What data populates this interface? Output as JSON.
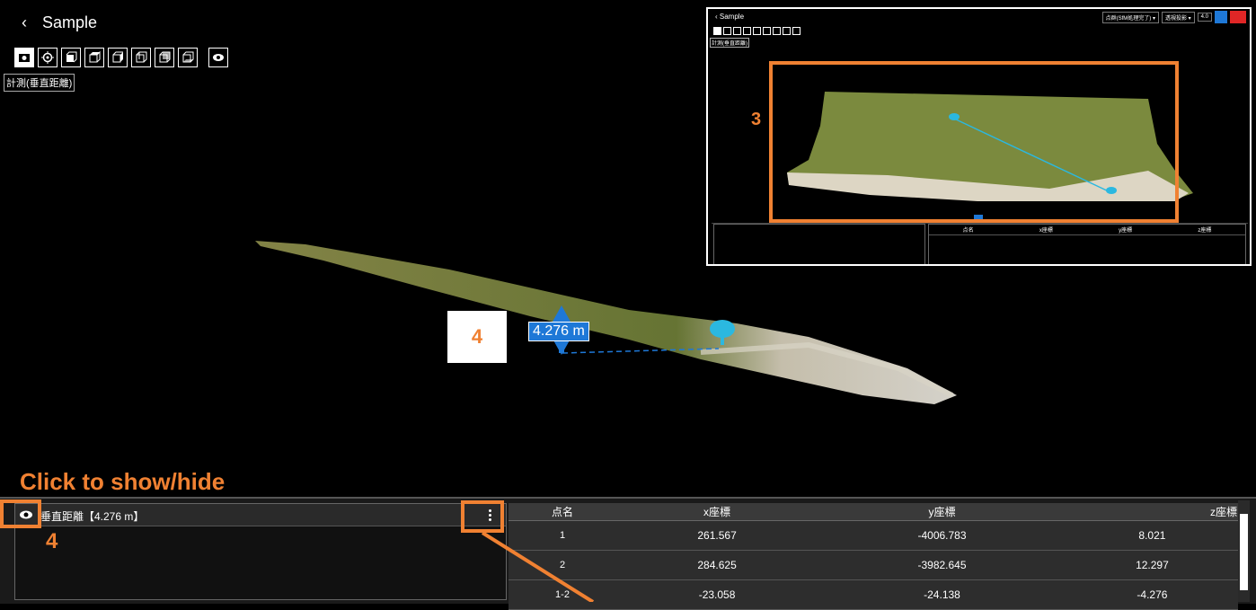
{
  "header": {
    "back_icon": "chevron-left-icon",
    "title": "Sample"
  },
  "toolbar": {
    "buttons": [
      "camera-icon",
      "target-icon",
      "cube-front-icon",
      "cube-top-icon",
      "cube-right-icon",
      "cube-left-icon",
      "cube-back-icon",
      "cube-bottom-icon"
    ],
    "eye_icon": "eye-icon",
    "mode_label": "計測(垂直距離)"
  },
  "viewport": {
    "measurement_label": "4.276 m",
    "marker_number": "4"
  },
  "inset": {
    "title": "Sample",
    "mode_label": "計測(垂直距離)",
    "dropdown1": "点群(SfM処理完了) ▾",
    "dropdown2": "透視投影 ▾",
    "value": "4.0",
    "marker_number": "3",
    "table_headers": [
      "点名",
      "x座標",
      "y座標",
      "z座標"
    ]
  },
  "annotations": {
    "click_label": "Click to show/hide",
    "eye_number": "4",
    "colors": {
      "accent": "#f08132",
      "measure": "#1e78d7"
    }
  },
  "list": {
    "item_label": "垂直距離【4.276 m】"
  },
  "table": {
    "headers": [
      "点名",
      "x座標",
      "y座標",
      "z座標"
    ],
    "rows": [
      {
        "name": "1",
        "x": "261.567",
        "y": "-4006.783",
        "z": "8.021"
      },
      {
        "name": "2",
        "x": "284.625",
        "y": "-3982.645",
        "z": "12.297"
      },
      {
        "name": "1-2",
        "x": "-23.058",
        "y": "-24.138",
        "z": "-4.276"
      }
    ]
  }
}
